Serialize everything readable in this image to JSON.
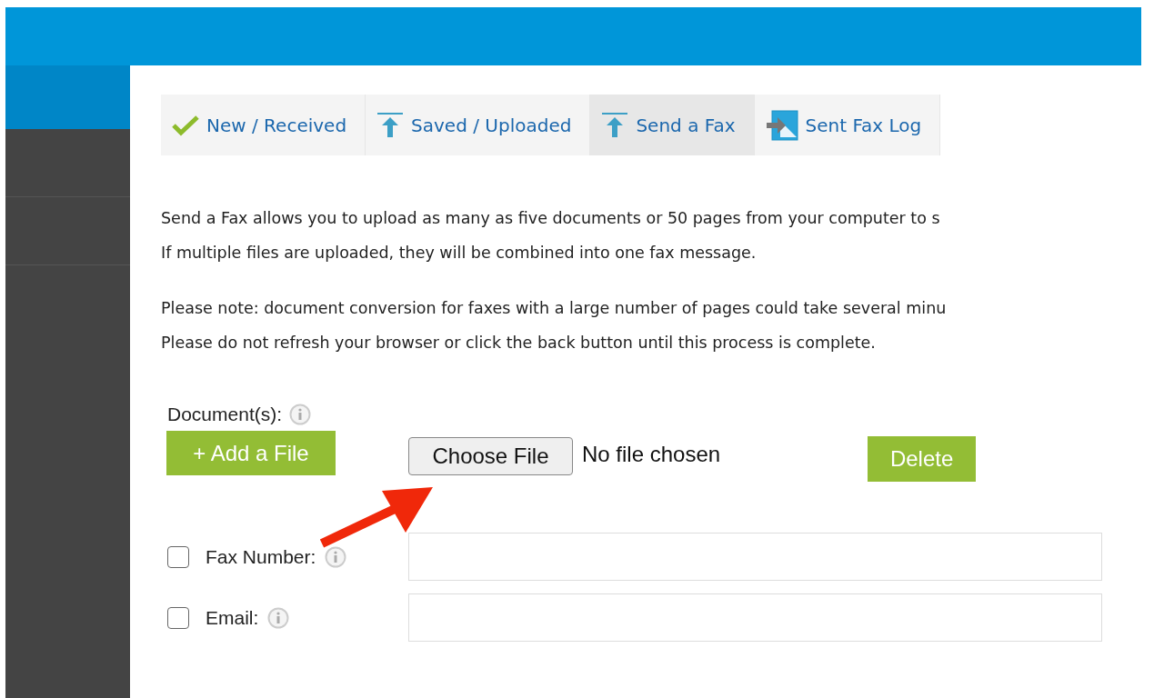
{
  "tabs": [
    {
      "label": "New / Received",
      "kind": "check",
      "selected": false
    },
    {
      "label": "Saved / Uploaded",
      "kind": "upload",
      "selected": false
    },
    {
      "label": "Send a Fax",
      "kind": "upload",
      "selected": true
    },
    {
      "label": "Sent Fax Log",
      "kind": "log",
      "selected": false
    }
  ],
  "intro": [
    "Send a Fax allows you to upload as many as five documents or 50 pages from your computer to s",
    "If multiple files are uploaded, they will be combined into one fax message."
  ],
  "note": [
    "Please note: document conversion for faxes with a large number of pages could take several minu",
    "Please do not refresh your browser or click the back button until this process is complete."
  ],
  "documents": {
    "label": "Document(s):",
    "add_button": "+ Add a File",
    "choose_button": "Choose File",
    "file_status": "No file chosen",
    "delete_button": "Delete"
  },
  "recipients": [
    {
      "label": "Fax Number:",
      "checked": false
    },
    {
      "label": "Email:",
      "checked": false
    }
  ]
}
